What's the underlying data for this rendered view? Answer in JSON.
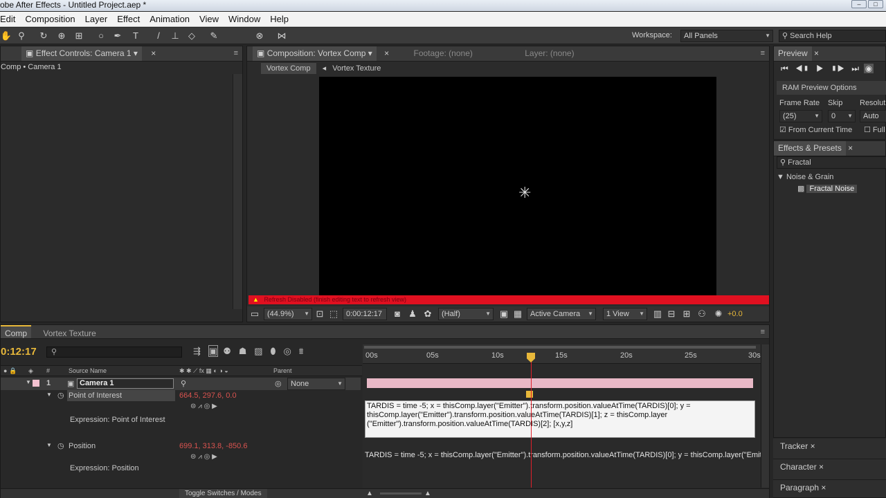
{
  "title_bar": {
    "title": "obe After Effects - Untitled Project.aep *"
  },
  "menu": [
    "Edit",
    "Composition",
    "Layer",
    "Effect",
    "Animation",
    "View",
    "Window",
    "Help"
  ],
  "workspace": {
    "label": "Workspace:",
    "value": "All Panels"
  },
  "search_help": {
    "placeholder": "Search Help"
  },
  "effect_controls": {
    "tab": "Effect Controls: Camera 1",
    "breadcrumb": "Comp • Camera 1"
  },
  "composition": {
    "tab": "Composition: Vortex Comp",
    "footage_tab": "Footage: (none)",
    "layer_tab": "Layer: (none)",
    "breadcrumb_current": "Vortex Comp",
    "breadcrumb_child": "Vortex Texture",
    "warning": "Refresh Disabled (finish editing text to refresh view)",
    "zoom": "(44.9%)",
    "timecode": "0:00:12:17",
    "resolution": "(Half)",
    "camera": "Active Camera",
    "views": "1 View",
    "exposure": "+0.0"
  },
  "preview": {
    "tab": "Preview",
    "ram_options": "RAM Preview Options",
    "frame_rate_label": "Frame Rate",
    "skip_label": "Skip",
    "resolution_label": "Resolut",
    "frame_rate": "(25)",
    "skip": "0",
    "resolution": "Auto",
    "from_current": "From Current Time",
    "full": "Full"
  },
  "effects_presets": {
    "tab": "Effects & Presets",
    "search": "Fractal",
    "category": "Noise & Grain",
    "item": "Fractal Noise"
  },
  "side_panels": [
    "Tracker",
    "Character",
    "Paragraph"
  ],
  "timeline": {
    "tab1": "Comp",
    "tab2": "Vortex Texture",
    "timecode": "0:12:17",
    "col_hash": "#",
    "col_source": "Source Name",
    "col_parent": "Parent",
    "ruler": [
      "00s",
      "05s",
      "10s",
      "15s",
      "20s",
      "25s",
      "30s"
    ],
    "layer_num": "1",
    "layer_name": "Camera 1",
    "parent_value": "None",
    "poi_label": "Point of Interest",
    "poi_value": "664.5, 297.6, 0.0",
    "expr_poi_label": "Expression: Point of Interest",
    "expr_poi": "TARDIS = time -5; x = thisComp.layer(\"Emitter\").transform.position.valueAtTime(TARDIS)[0]; y = thisComp.layer(\"Emitter\").transform.position.valueAtTime(TARDIS)[1]; z = thisComp.layer (\"Emitter\").transform.position.valueAtTime(TARDIS)[2]; [x,y,z]",
    "pos_label": "Position",
    "pos_value": "699.1, 313.8, -850.6",
    "expr_pos_label": "Expression: Position",
    "expr_pos": "TARDIS = time -5; x = thisComp.layer(\"Emitter\").transform.position.valueAtTime(TARDIS)[0]; y = thisComp.layer(\"Emitter\").transform.position.valueAtTime(TARDIS)[1]; y = thisComp.laye",
    "toggle": "Toggle Switches / Modes"
  }
}
